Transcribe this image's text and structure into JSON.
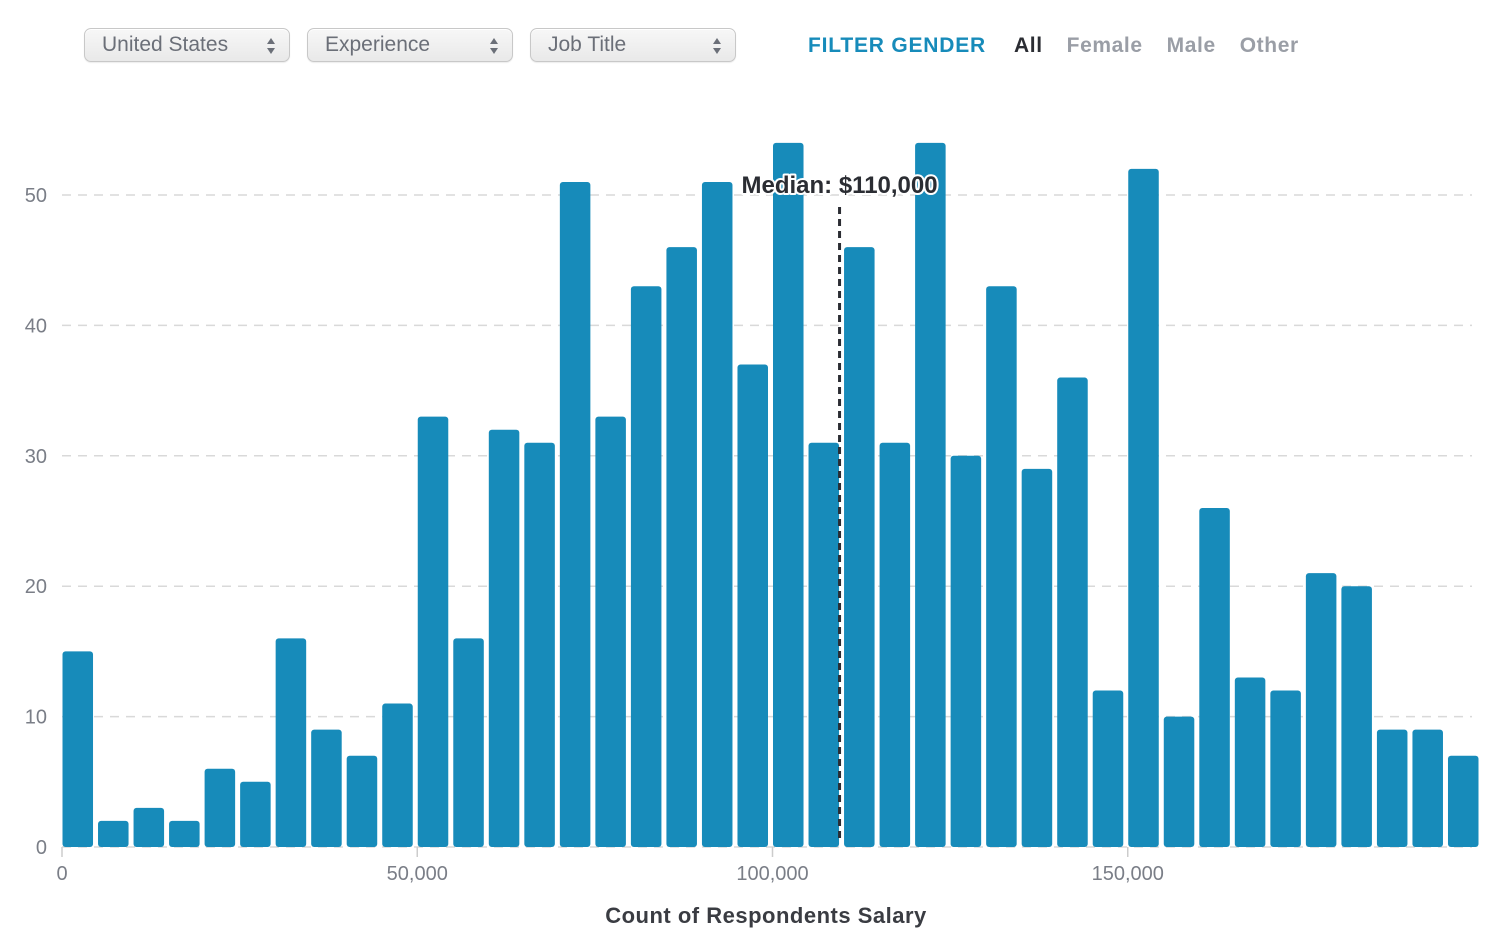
{
  "filters": {
    "country": {
      "label": "United States",
      "icon": "up-down-arrows-icon"
    },
    "experience": {
      "label": "Experience",
      "icon": "up-down-arrows-icon"
    },
    "job_title": {
      "label": "Job Title",
      "icon": "up-down-arrows-icon"
    }
  },
  "gender_filter": {
    "title": "FILTER GENDER",
    "options": [
      "All",
      "Female",
      "Male",
      "Other"
    ],
    "selected": "All"
  },
  "colors": {
    "bar": "#178bba",
    "accent": "#178bba",
    "gridline": "#d9d9d9",
    "median_line": "#2b2d33"
  },
  "chart_data": {
    "type": "bar",
    "title": "",
    "xlabel": "Count of Respondents Salary",
    "ylabel": "",
    "bin_width": 5000,
    "bin_starts": [
      0,
      5000,
      10000,
      15000,
      20000,
      25000,
      30000,
      35000,
      40000,
      45000,
      50000,
      55000,
      60000,
      65000,
      70000,
      75000,
      80000,
      85000,
      90000,
      95000,
      100000,
      105000,
      110000,
      115000,
      120000,
      125000,
      130000,
      135000,
      140000,
      145000,
      150000,
      155000,
      160000,
      165000,
      170000,
      175000,
      180000,
      185000,
      190000,
      195000
    ],
    "values": [
      15,
      2,
      3,
      2,
      6,
      5,
      16,
      9,
      7,
      11,
      33,
      16,
      32,
      31,
      51,
      33,
      43,
      46,
      51,
      37,
      54,
      31,
      46,
      31,
      54,
      30,
      43,
      29,
      36,
      12,
      52,
      10,
      26,
      13,
      12,
      21,
      20,
      9,
      9,
      7
    ],
    "xlim": [
      0,
      200000
    ],
    "ylim": [
      0,
      55
    ],
    "xticks": [
      0,
      50000,
      100000,
      150000
    ],
    "xtick_labels": [
      "0",
      "50,000",
      "100,000",
      "150,000"
    ],
    "yticks": [
      0,
      10,
      20,
      30,
      40,
      50
    ],
    "ytick_labels": [
      "0",
      "10",
      "20",
      "30",
      "40",
      "50"
    ],
    "grid": true,
    "annotations": [
      {
        "type": "vline",
        "x": 110000,
        "label": "Median: $110,000",
        "style": "dashed"
      }
    ]
  }
}
